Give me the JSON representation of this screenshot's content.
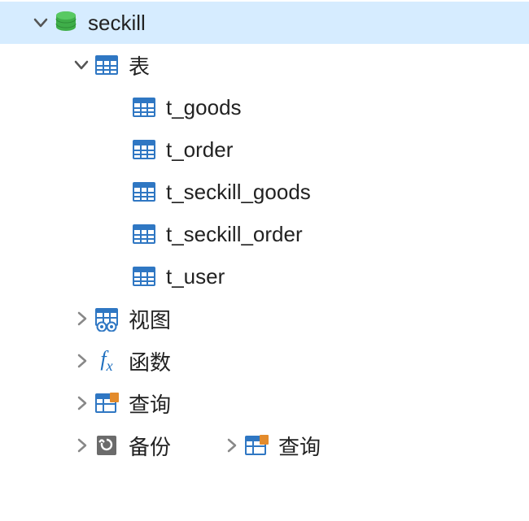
{
  "database": {
    "name": "seckill",
    "children": {
      "tables": {
        "label": "表",
        "items": [
          {
            "name": "t_goods"
          },
          {
            "name": "t_order"
          },
          {
            "name": "t_seckill_goods"
          },
          {
            "name": "t_seckill_order"
          },
          {
            "name": "t_user"
          }
        ]
      },
      "views": {
        "label": "视图"
      },
      "functions": {
        "label": "函数"
      },
      "queries": {
        "label": "查询"
      },
      "backups": {
        "label": "备份"
      }
    }
  },
  "footer": {
    "query_label": "查询"
  }
}
